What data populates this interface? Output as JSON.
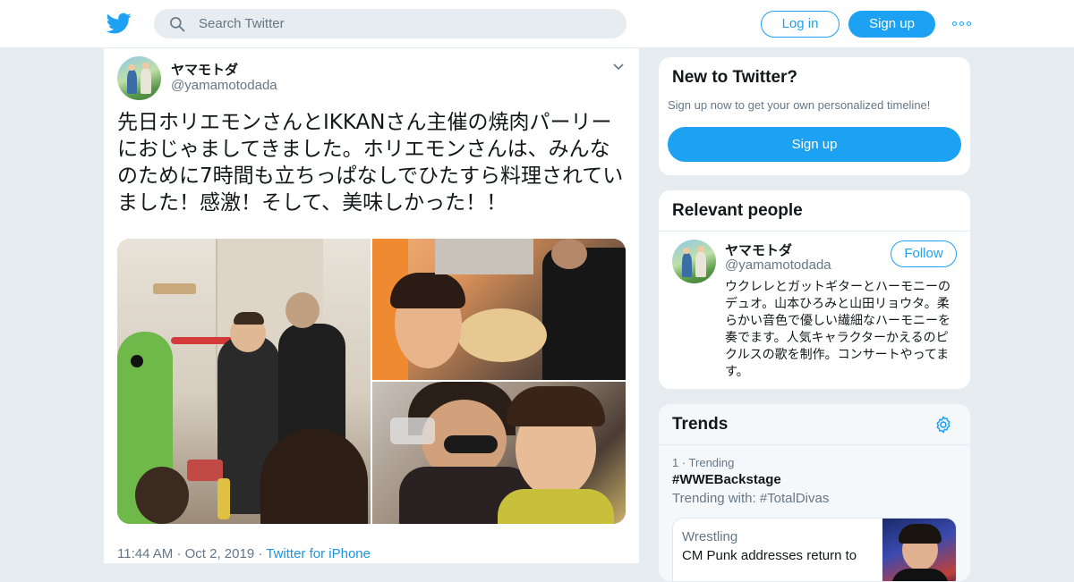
{
  "header": {
    "logo_icon": "twitter-bird-icon",
    "search_placeholder": "Search Twitter",
    "login_label": "Log in",
    "signup_label": "Sign up",
    "more_icon": "more-dots-icon"
  },
  "tweet": {
    "author_name": "ヤマモトダ",
    "author_handle": "@yamamotodada",
    "text": "先日ホリエモンさんとIKKANさん主催の焼肉パーリーにおじゃましてきました。ホリエモンさんは、みんなのために7時間も立ちっぱなしでひたすら料理されていました！感激！そして、美味しかった！！",
    "time": "11:44 AM",
    "date": "Oct 2, 2019",
    "source": "Twitter for iPhone",
    "separator": "·"
  },
  "new_to_twitter": {
    "title": "New to Twitter?",
    "subtitle": "Sign up now to get your own personalized timeline!",
    "button": "Sign up"
  },
  "relevant_people": {
    "title": "Relevant people",
    "name": "ヤマモトダ",
    "handle": "@yamamotodada",
    "follow_label": "Follow",
    "bio": "ウクレレとガットギターとハーモニーのデュオ。山本ひろみと山田リョウタ。柔らかい音色で優しい繊細なハーモニーを奏でます。人気キャラクターかえるのピクルスの歌を制作。コンサートやってます。"
  },
  "trends": {
    "title": "Trends",
    "rank_label": "1 · Trending",
    "tag": "#WWEBackstage",
    "trending_with": "Trending with: #TotalDivas",
    "news_category": "Wrestling",
    "news_headline": "CM Punk addresses return to"
  },
  "colors": {
    "accent": "#1da1f2",
    "background": "#e6ecf0",
    "secondary_text": "#657786"
  }
}
